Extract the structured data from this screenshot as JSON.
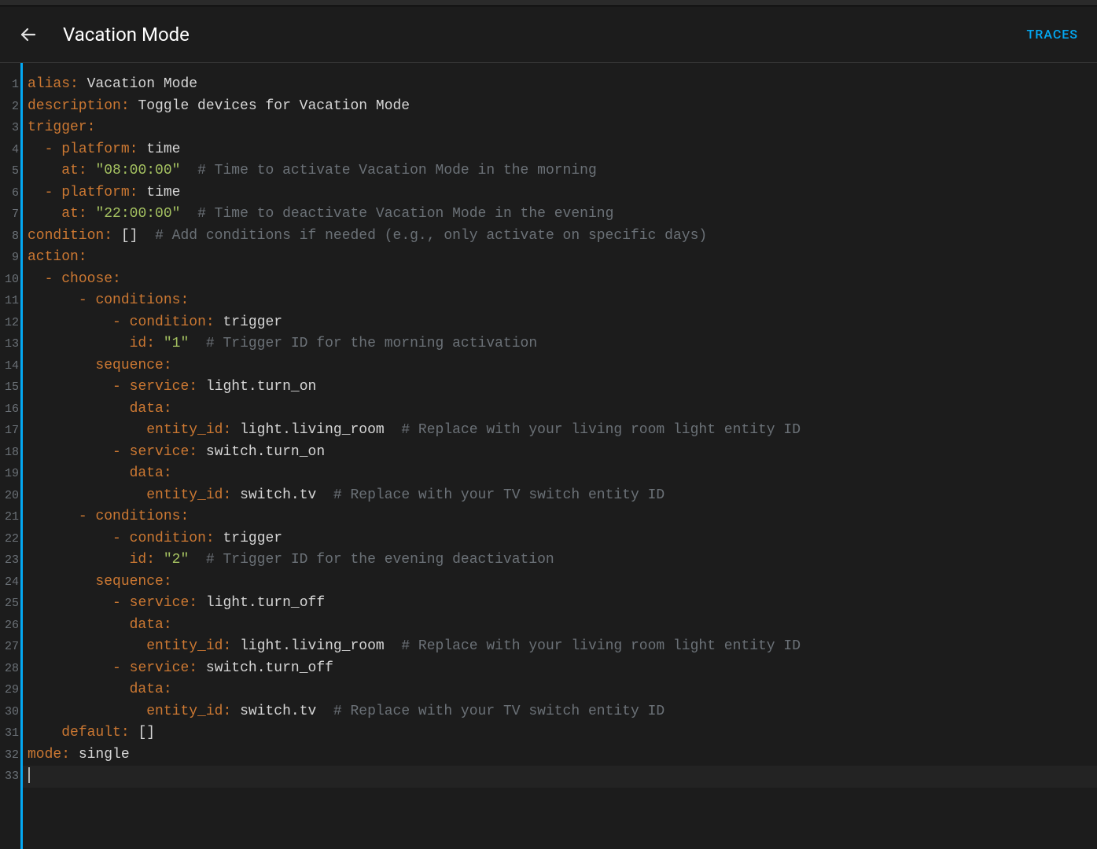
{
  "header": {
    "title": "Vacation Mode",
    "traces_label": "TRACES"
  },
  "editor": {
    "line_count": 33,
    "current_line": 33,
    "yaml": {
      "alias": "Vacation Mode",
      "description": "Toggle devices for Vacation Mode",
      "trigger": [
        {
          "platform": "time",
          "at": "08:00:00",
          "comment": "# Time to activate Vacation Mode in the morning"
        },
        {
          "platform": "time",
          "at": "22:00:00",
          "comment": "# Time to deactivate Vacation Mode in the evening"
        }
      ],
      "condition_raw": "[]",
      "condition_comment": "# Add conditions if needed (e.g., only activate on specific days)",
      "action": {
        "choose": [
          {
            "conditions": [
              {
                "condition": "trigger",
                "id": "1",
                "id_comment": "# Trigger ID for the morning activation"
              }
            ],
            "sequence": [
              {
                "service": "light.turn_on",
                "entity_id": "light.living_room",
                "entity_comment": "# Replace with your living room light entity ID"
              },
              {
                "service": "switch.turn_on",
                "entity_id": "switch.tv",
                "entity_comment": "# Replace with your TV switch entity ID"
              }
            ]
          },
          {
            "conditions": [
              {
                "condition": "trigger",
                "id": "2",
                "id_comment": "# Trigger ID for the evening deactivation"
              }
            ],
            "sequence": [
              {
                "service": "light.turn_off",
                "entity_id": "light.living_room",
                "entity_comment": "# Replace with your living room light entity ID"
              },
              {
                "service": "switch.turn_off",
                "entity_id": "switch.tv",
                "entity_comment": "# Replace with your TV switch entity ID"
              }
            ]
          }
        ],
        "default_raw": "[]"
      },
      "mode": "single"
    },
    "labels": {
      "alias": "alias",
      "description": "description",
      "trigger": "trigger",
      "platform": "platform",
      "at": "at",
      "condition": "condition",
      "action": "action",
      "choose": "choose",
      "conditions": "conditions",
      "id": "id",
      "sequence": "sequence",
      "service": "service",
      "data": "data",
      "entity_id": "entity_id",
      "default": "default",
      "mode": "mode",
      "time": "time"
    }
  }
}
